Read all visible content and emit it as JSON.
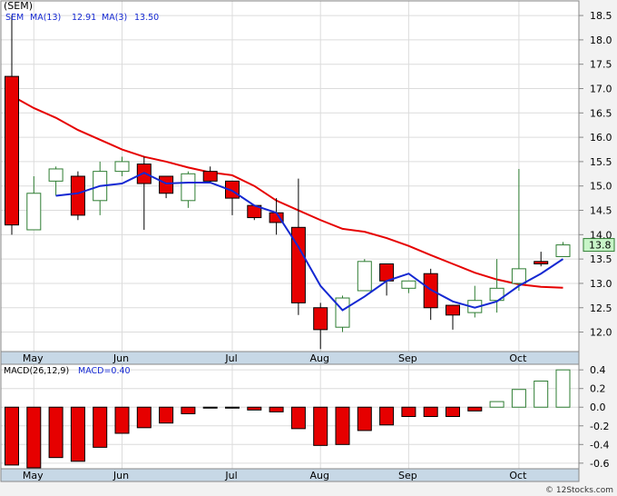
{
  "colors": {
    "background": "#f2f2f2",
    "plot_background": "#ffffff",
    "grid": "#dcdcdc",
    "axis_band": "#c7d8e6",
    "up_candle": "#2e7d32",
    "down_candle": "#e60000",
    "ma13": "#e60000",
    "ma3": "#1428d2",
    "macd_pos": "#2e7d32",
    "macd_neg": "#e60000",
    "legend_text": "#1428d2"
  },
  "chart_data": [
    {
      "type": "candlestick",
      "legend": {
        "symbol": "SEM",
        "ma13_label": "MA(13)",
        "ma13_value": "12.91",
        "ma3_label": "MA(3)",
        "ma3_value": "13.50"
      },
      "symbol_title": "(SEM)",
      "ylim": [
        11.6,
        18.8
      ],
      "yticks": [
        12.0,
        12.5,
        13.0,
        13.5,
        14.0,
        14.5,
        15.0,
        15.5,
        16.0,
        16.5,
        17.0,
        17.5,
        18.0,
        18.5
      ],
      "ytick_labels": [
        "12.0",
        "12.5",
        "13.0",
        "13.5",
        "14.0",
        "14.5",
        "15.0",
        "15.5",
        "16.0",
        "16.5",
        "17.0",
        "17.5",
        "18.0",
        "18.5"
      ],
      "last_price_label": "13.8",
      "last_price": 13.79,
      "months": [
        {
          "label": "May",
          "index": 1
        },
        {
          "label": "Jun",
          "index": 5
        },
        {
          "label": "Jul",
          "index": 10
        },
        {
          "label": "Aug",
          "index": 14
        },
        {
          "label": "Sep",
          "index": 18
        },
        {
          "label": "Oct",
          "index": 23
        }
      ],
      "candles": [
        {
          "o": 17.25,
          "h": 18.5,
          "l": 14.0,
          "c": 14.2
        },
        {
          "o": 14.1,
          "h": 15.2,
          "l": 14.1,
          "c": 14.85
        },
        {
          "o": 15.1,
          "h": 15.4,
          "l": 14.8,
          "c": 15.35
        },
        {
          "o": 15.2,
          "h": 15.3,
          "l": 14.3,
          "c": 14.4
        },
        {
          "o": 14.7,
          "h": 15.5,
          "l": 14.4,
          "c": 15.3
        },
        {
          "o": 15.3,
          "h": 15.6,
          "l": 15.2,
          "c": 15.5
        },
        {
          "o": 15.45,
          "h": 15.6,
          "l": 14.1,
          "c": 15.05
        },
        {
          "o": 15.2,
          "h": 15.2,
          "l": 14.75,
          "c": 14.85
        },
        {
          "o": 14.7,
          "h": 15.3,
          "l": 14.55,
          "c": 15.25
        },
        {
          "o": 15.3,
          "h": 15.4,
          "l": 15.05,
          "c": 15.1
        },
        {
          "o": 15.1,
          "h": 15.1,
          "l": 14.4,
          "c": 14.75
        },
        {
          "o": 14.6,
          "h": 14.6,
          "l": 14.3,
          "c": 14.35
        },
        {
          "o": 14.45,
          "h": 14.75,
          "l": 14.0,
          "c": 14.25
        },
        {
          "o": 14.15,
          "h": 15.15,
          "l": 12.35,
          "c": 12.6
        },
        {
          "o": 12.5,
          "h": 12.6,
          "l": 11.65,
          "c": 12.05
        },
        {
          "o": 12.1,
          "h": 12.75,
          "l": 12.0,
          "c": 12.7
        },
        {
          "o": 12.85,
          "h": 13.5,
          "l": 12.85,
          "c": 13.45
        },
        {
          "o": 13.4,
          "h": 13.4,
          "l": 12.75,
          "c": 13.05
        },
        {
          "o": 12.9,
          "h": 13.05,
          "l": 12.8,
          "c": 13.05
        },
        {
          "o": 13.2,
          "h": 13.3,
          "l": 12.25,
          "c": 12.5
        },
        {
          "o": 12.55,
          "h": 12.55,
          "l": 12.05,
          "c": 12.35
        },
        {
          "o": 12.4,
          "h": 12.95,
          "l": 12.3,
          "c": 12.65
        },
        {
          "o": 12.65,
          "h": 13.5,
          "l": 12.4,
          "c": 12.9
        },
        {
          "o": 13.0,
          "h": 15.35,
          "l": 12.85,
          "c": 13.3
        },
        {
          "o": 13.45,
          "h": 13.65,
          "l": 13.35,
          "c": 13.4
        },
        {
          "o": 13.55,
          "h": 13.85,
          "l": 13.55,
          "c": 13.79
        }
      ],
      "ma13": [
        {
          "i": 0,
          "v": 16.85
        },
        {
          "i": 1,
          "v": 16.6
        },
        {
          "i": 2,
          "v": 16.4
        },
        {
          "i": 3,
          "v": 16.15
        },
        {
          "i": 4,
          "v": 15.95
        },
        {
          "i": 5,
          "v": 15.75
        },
        {
          "i": 6,
          "v": 15.6
        },
        {
          "i": 7,
          "v": 15.5
        },
        {
          "i": 8,
          "v": 15.38
        },
        {
          "i": 9,
          "v": 15.28
        },
        {
          "i": 10,
          "v": 15.22
        },
        {
          "i": 11,
          "v": 15.0
        },
        {
          "i": 12,
          "v": 14.7
        },
        {
          "i": 13,
          "v": 14.5
        },
        {
          "i": 14,
          "v": 14.3
        },
        {
          "i": 15,
          "v": 14.12
        },
        {
          "i": 16,
          "v": 14.06
        },
        {
          "i": 17,
          "v": 13.93
        },
        {
          "i": 18,
          "v": 13.77
        },
        {
          "i": 19,
          "v": 13.58
        },
        {
          "i": 20,
          "v": 13.4
        },
        {
          "i": 21,
          "v": 13.22
        },
        {
          "i": 22,
          "v": 13.08
        },
        {
          "i": 23,
          "v": 12.98
        },
        {
          "i": 24,
          "v": 12.93
        },
        {
          "i": 25,
          "v": 12.91
        }
      ],
      "ma3": [
        {
          "i": 0,
          "v": 16.0
        },
        {
          "i": 1,
          "v": 15.45
        },
        {
          "i": 2,
          "v": 14.8
        },
        {
          "i": 3,
          "v": 14.85
        },
        {
          "i": 4,
          "v": 15.0
        },
        {
          "i": 5,
          "v": 15.05
        },
        {
          "i": 6,
          "v": 15.27
        },
        {
          "i": 7,
          "v": 15.05
        },
        {
          "i": 8,
          "v": 15.07
        },
        {
          "i": 9,
          "v": 15.07
        },
        {
          "i": 10,
          "v": 14.9
        },
        {
          "i": 11,
          "v": 14.6
        },
        {
          "i": 12,
          "v": 14.45
        },
        {
          "i": 13,
          "v": 13.75
        },
        {
          "i": 14,
          "v": 12.95
        },
        {
          "i": 15,
          "v": 12.45
        },
        {
          "i": 16,
          "v": 12.73
        },
        {
          "i": 17,
          "v": 13.05
        },
        {
          "i": 18,
          "v": 13.2
        },
        {
          "i": 19,
          "v": 12.87
        },
        {
          "i": 20,
          "v": 12.63
        },
        {
          "i": 21,
          "v": 12.5
        },
        {
          "i": 22,
          "v": 12.63
        },
        {
          "i": 23,
          "v": 12.95
        },
        {
          "i": 24,
          "v": 13.2
        },
        {
          "i": 25,
          "v": 13.5
        }
      ]
    },
    {
      "type": "bar",
      "legend": {
        "label": "MACD(26,12,9)",
        "value_label": "MACD=0.40"
      },
      "ylim": [
        -0.66,
        0.46
      ],
      "yticks": [
        0.4,
        0.2,
        0.0,
        -0.2,
        -0.4,
        -0.6
      ],
      "ytick_labels": [
        "0.4",
        "0.2",
        "0.0",
        "-0.2",
        "-0.4",
        "-0.6"
      ],
      "values": [
        -0.62,
        -0.65,
        -0.54,
        -0.58,
        -0.43,
        -0.28,
        -0.22,
        -0.17,
        -0.07,
        -0.01,
        -0.01,
        -0.03,
        -0.05,
        -0.23,
        -0.41,
        -0.4,
        -0.25,
        -0.19,
        -0.1,
        -0.1,
        -0.1,
        -0.04,
        0.06,
        0.19,
        0.28,
        0.4
      ]
    }
  ],
  "watermark": "© 12Stocks.com"
}
